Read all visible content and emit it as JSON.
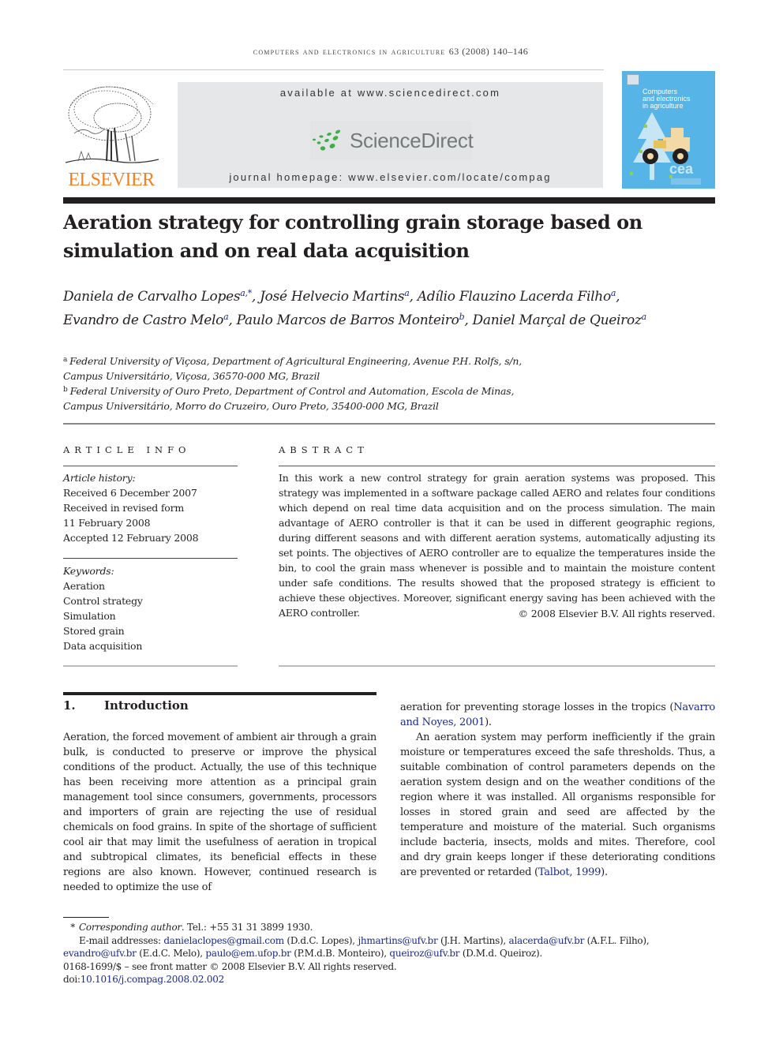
{
  "running_header": {
    "journal": "computers and electronics in agriculture",
    "volume_info": "63 (2008) 140–146"
  },
  "masthead": {
    "publisher_logo_text": "ELSEVIER",
    "available_at": "available at www.sciencedirect.com",
    "sciencedirect_logo_text": "ScienceDirect",
    "journal_homepage": "journal homepage: www.elsevier.com/locate/compag",
    "cover": {
      "title_lines": [
        "Computers",
        "and electronics",
        "in agriculture"
      ],
      "badge": "cea"
    },
    "colors": {
      "elsevier_orange": "#f4801f",
      "sciencedirect_green": "#3fae49",
      "cover_blue": "#57b4e6",
      "masthead_gray": "#e6e7e8",
      "link_blue": "#1a2a8a"
    }
  },
  "article": {
    "title": "Aeration strategy for controlling grain storage based on simulation and on real data acquisition",
    "authors": [
      {
        "name": "Daniela de Carvalho Lopes",
        "marks": "a,*"
      },
      {
        "name": "José Helvecio Martins",
        "marks": "a"
      },
      {
        "name": "Adílio Flauzino Lacerda Filho",
        "marks": "a"
      },
      {
        "name": "Evandro de Castro Melo",
        "marks": "a"
      },
      {
        "name": "Paulo Marcos de Barros Monteiro",
        "marks": "b"
      },
      {
        "name": "Daniel Marçal de Queiroz",
        "marks": "a"
      }
    ],
    "affiliations": [
      {
        "mark": "a",
        "line1": "Federal University of Viçosa, Department of Agricultural Engineering, Avenue P.H. Rolfs, s/n,",
        "line2": "Campus Universitário, Viçosa, 36570-000 MG, Brazil"
      },
      {
        "mark": "b",
        "line1": "Federal University of Ouro Preto, Department of Control and Automation, Escola de Minas,",
        "line2": "Campus Universitário, Morro do Cruzeiro, Ouro Preto, 35400-000 MG, Brazil"
      }
    ]
  },
  "article_info": {
    "heading": "ARTICLE INFO",
    "history_label": "Article history:",
    "history": [
      "Received 6 December 2007",
      "Received in revised form",
      "11 February 2008",
      "Accepted 12 February 2008"
    ],
    "keywords_label": "Keywords:",
    "keywords": [
      "Aeration",
      "Control strategy",
      "Simulation",
      "Stored grain",
      "Data acquisition"
    ]
  },
  "abstract": {
    "heading": "ABSTRACT",
    "text": "In this work a new control strategy for grain aeration systems was proposed. This strategy was implemented in a software package called AERO and relates four conditions which depend on real time data acquisition and on the process simulation. The main advantage of AERO controller is that it can be used in different geographic regions, during different seasons and with different aeration systems, automatically adjusting its set points. The objectives of AERO controller are to equalize the temperatures inside the bin, to cool the grain mass whenever is possible and to maintain the moisture content under safe conditions. The results showed that the proposed strategy is efficient to achieve these objectives. Moreover, significant energy saving has been achieved with the AERO controller.",
    "copyright": "© 2008 Elsevier B.V. All rights reserved."
  },
  "introduction": {
    "number": "1.",
    "heading": "Introduction",
    "left_column": "Aeration, the forced movement of ambient air through a grain bulk, is conducted to preserve or improve the physical conditions of the product. Actually, the use of this technique has been receiving more attention as a principal grain management tool since consumers, governments, processors and importers of grain are rejecting the use of residual chemicals on food grains. In spite of the shortage of sufficient cool air that may limit the usefulness of aeration in tropical and subtropical climates, its beneficial effects in these regions are also known. However, continued research is needed to optimize the use of",
    "right_p1_before": "aeration for preventing storage losses in the tropics (",
    "right_p1_cite": "Navarro and Noyes, 2001",
    "right_p1_after": ").",
    "right_p2_before": "An aeration system may perform inefficiently if the grain moisture or temperatures exceed the safe thresholds. Thus, a suitable combination of control parameters depends on the aeration system design and on the weather conditions of the region where it was installed. All organisms responsible for losses in stored grain and seed are affected by the temperature and moisture of the material. Such organisms include bacteria, insects, molds and mites. Therefore, cool and dry grain keeps longer if these deteriorating conditions are prevented or retarded (",
    "right_p2_cite": "Talbot, 1999",
    "right_p2_after": ")."
  },
  "footnotes": {
    "star": "*",
    "corresponding_label": "Corresponding author",
    "corresponding_rest": ". Tel.: +55 31 31 3899 1930.",
    "email_label": "E-mail addresses: ",
    "emails": [
      {
        "address": "danielaclopes@gmail.com",
        "owner": " (D.d.C. Lopes), "
      },
      {
        "address": "jhmartins@ufv.br",
        "owner": " (J.H. Martins), "
      },
      {
        "address": "alacerda@ufv.br",
        "owner": " (A.F.L. Filho), "
      },
      {
        "address": "evandro@ufv.br",
        "owner": " (E.d.C. Melo), "
      },
      {
        "address": "paulo@em.ufop.br",
        "owner": " (P.M.d.B. Monteiro), "
      },
      {
        "address": "queiroz@ufv.br",
        "owner": " (D.M.d. Queiroz)."
      }
    ],
    "front_matter": "0168-1699/$ – see front matter © 2008 Elsevier B.V. All rights reserved.",
    "doi_label": "doi:",
    "doi": "10.1016/j.compag.2008.02.002"
  }
}
